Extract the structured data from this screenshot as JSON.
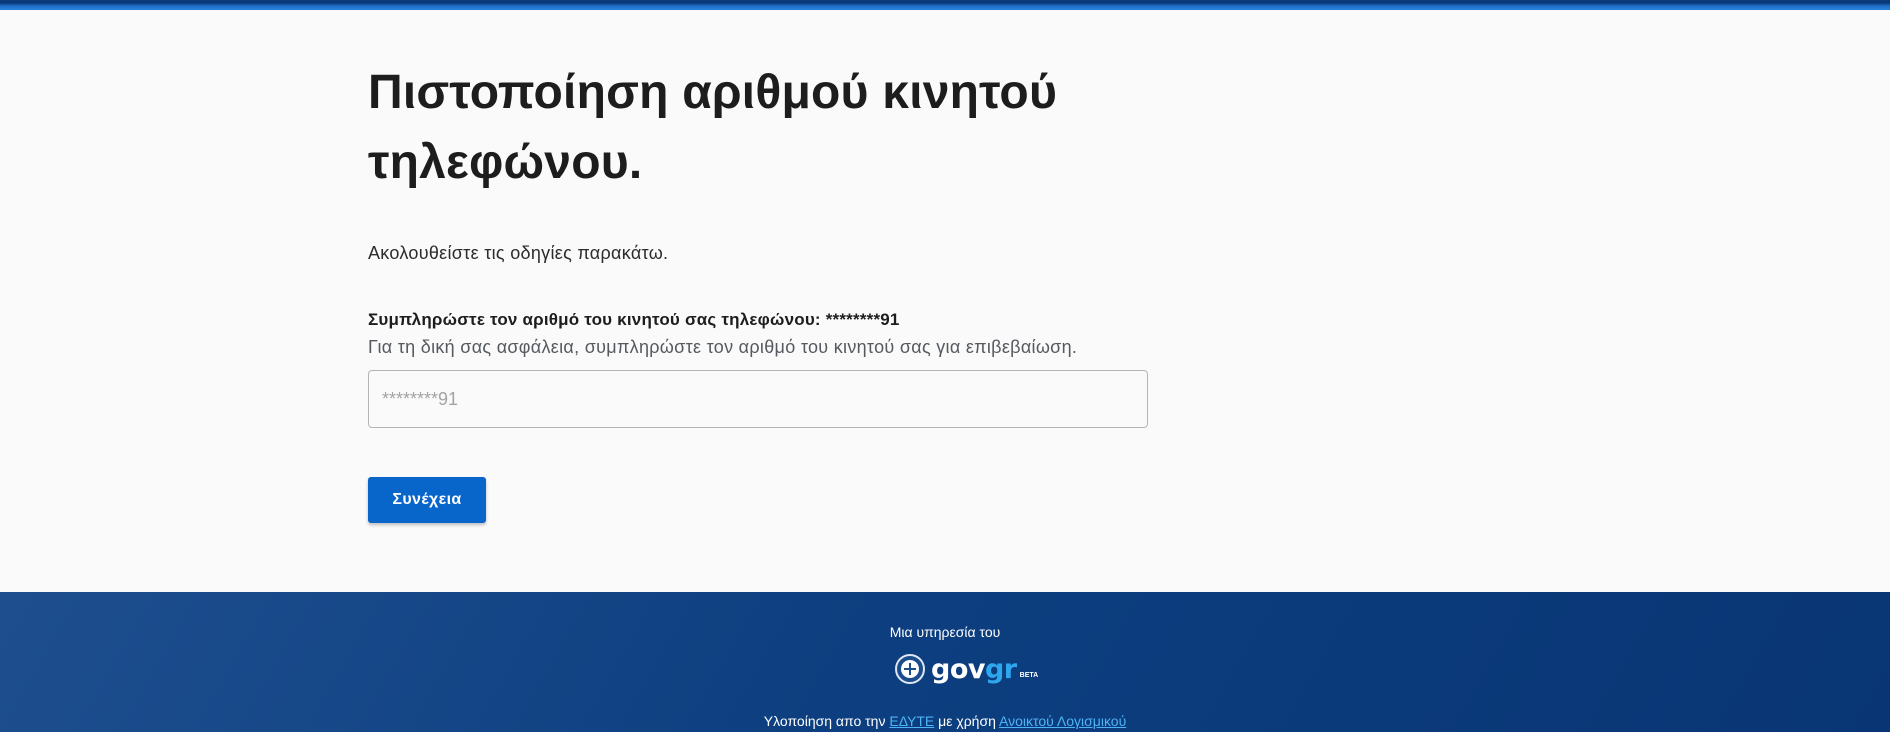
{
  "colors": {
    "primary_button": "#0865c9",
    "footer_background": "#0d3f80",
    "link": "#4db3f5",
    "top_bar": "#1f6fc8"
  },
  "main": {
    "title": "Πιστοποίηση αριθμού κινητού τηλεφώνου.",
    "intro": "Ακολουθείστε τις οδηγίες παρακάτω.",
    "field_label": "Συμπληρώστε τον αριθμό του κινητού σας τηλεφώνου:",
    "masked_number": "********91",
    "field_hint": "Για τη δική σας ασφάλεια, συμπληρώστε τον αριθμό του κινητού σας για επιβεβαίωση.",
    "input_placeholder": "********91",
    "input_value": "",
    "continue_label": "Συνέχεια"
  },
  "footer": {
    "service_text": "Μια υπηρεσία του",
    "brand_gov": "gov",
    "brand_gr": "gr",
    "brand_beta": "BETA",
    "credits_prefix": "Υλοποίηση απο την",
    "credits_org_link": "ΕΔΥΤΕ",
    "credits_middle": "με χρήση",
    "credits_software_link": "Ανοικτού Λογισμικού",
    "icons": {
      "emblem": "greek-emblem-icon"
    }
  }
}
